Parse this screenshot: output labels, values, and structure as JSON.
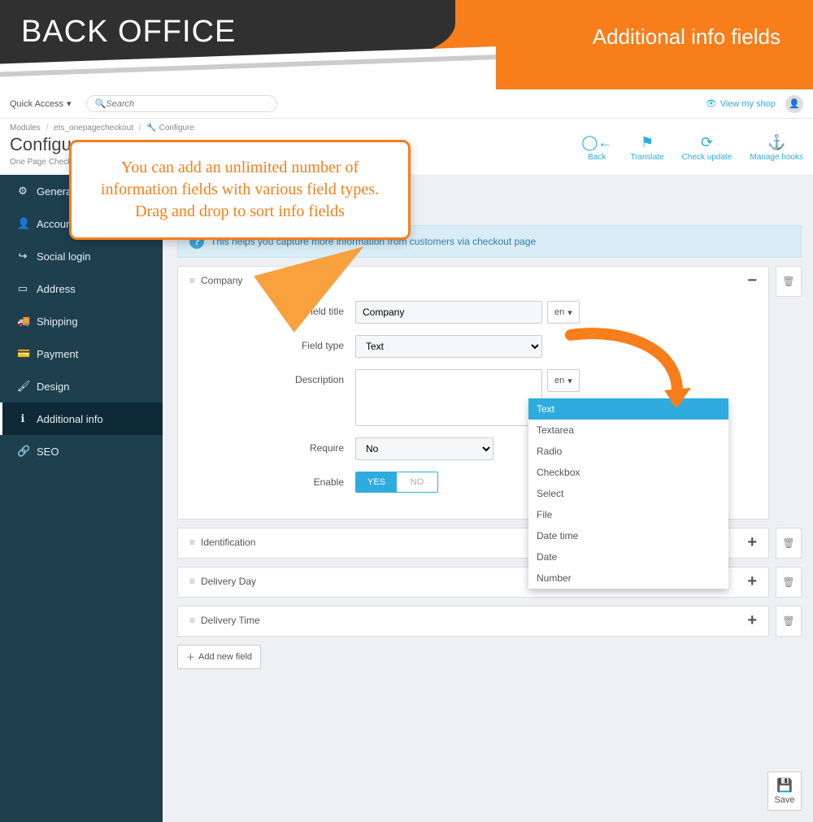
{
  "promo": {
    "title": "BACK OFFICE",
    "subtitle": "Additional info fields"
  },
  "topbar": {
    "quick_access": "Quick Access",
    "search_placeholder": "Search",
    "view_shop": "View my shop"
  },
  "breadcrumbs": {
    "a": "Modules",
    "b": "ets_onepagecheckout",
    "c": "Configure"
  },
  "page": {
    "title": "Configure",
    "subtitle": "One Page Checkout"
  },
  "head_actions": {
    "back": "Back",
    "translate": "Translate",
    "check": "Check update",
    "hooks": "Manage hooks"
  },
  "sidebar": {
    "items": [
      {
        "icon": "⚙",
        "label": "General"
      },
      {
        "icon": "👤",
        "label": "Account"
      },
      {
        "icon": "↪",
        "label": "Social login"
      },
      {
        "icon": "▭",
        "label": "Address"
      },
      {
        "icon": "🚚",
        "label": "Shipping"
      },
      {
        "icon": "💳",
        "label": "Payment"
      },
      {
        "icon": "🖌",
        "label": "Design"
      },
      {
        "icon": "ℹ",
        "label": "Additional info"
      },
      {
        "icon": "🔗",
        "label": "SEO"
      }
    ]
  },
  "notice": "This helps you capture more information from customers via checkout page",
  "field_panel": {
    "title": "Company",
    "labels": {
      "field_title": "Field title",
      "field_type": "Field type",
      "description": "Description",
      "require": "Require",
      "enable": "Enable"
    },
    "values": {
      "field_title": "Company",
      "field_type": "Text",
      "require": "No"
    },
    "lang": "en",
    "switch_yes": "YES",
    "switch_no": "NO"
  },
  "collapsed": [
    {
      "title": "Identification"
    },
    {
      "title": "Delivery Day"
    },
    {
      "title": "Delivery Time"
    }
  ],
  "add_new": "Add new field",
  "save": "Save",
  "dropdown": {
    "options": [
      "Text",
      "Textarea",
      "Radio",
      "Checkbox",
      "Select",
      "File",
      "Date time",
      "Date",
      "Number"
    ],
    "selected": "Text"
  },
  "callout": "You can add an unlimited number of information fields with various field types. Drag and drop to sort info fields"
}
